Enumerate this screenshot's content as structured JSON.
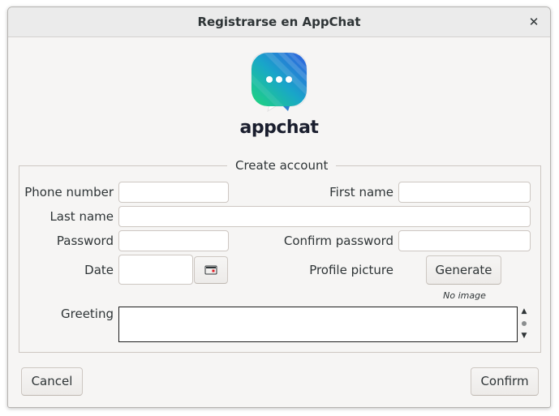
{
  "window": {
    "title": "Registrarse en AppChat",
    "close_glyph": "✕"
  },
  "logo": {
    "icon": "appchat-chat-bubble-logo",
    "brand_text": "appchat"
  },
  "form": {
    "legend": "Create account",
    "phone_label": "Phone number",
    "phone_value": "",
    "first_name_label": "First name",
    "first_name_value": "",
    "last_name_label": "Last name",
    "last_name_value": "",
    "password_label": "Password",
    "password_value": "",
    "confirm_password_label": "Confirm password",
    "confirm_password_value": "",
    "date_label": "Date",
    "date_value": "",
    "date_picker_icon": "calendar-icon",
    "profile_picture_label": "Profile picture",
    "generate_label": "Generate",
    "no_image_text": "No image",
    "greeting_label": "Greeting",
    "greeting_value": ""
  },
  "actions": {
    "cancel_label": "Cancel",
    "confirm_label": "Confirm"
  }
}
